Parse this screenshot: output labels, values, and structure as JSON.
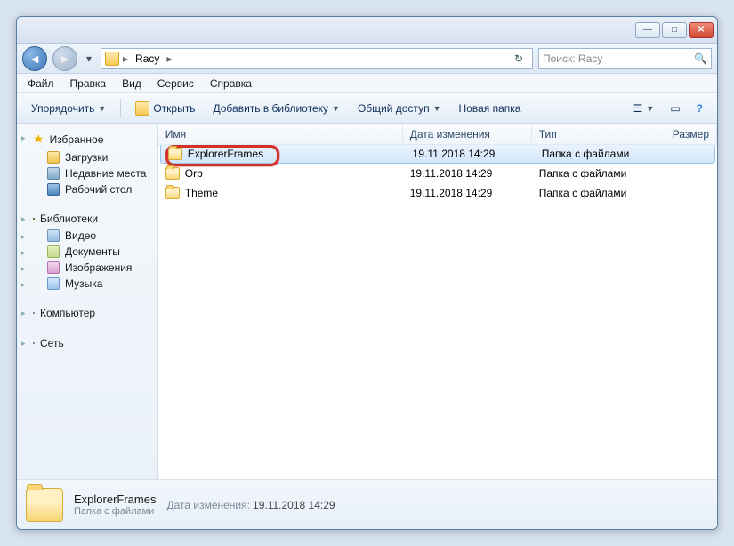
{
  "titlebar": {
    "min": "—",
    "max": "□",
    "close": "✕"
  },
  "nav": {
    "back": "◄",
    "forward": "►",
    "dropdown": "▾",
    "crumb_root": "",
    "crumb_folder": "Racy",
    "sep": "▸",
    "refresh": "↻"
  },
  "search": {
    "placeholder": "Поиск: Racy",
    "icon": "🔍"
  },
  "menubar": {
    "file": "Файл",
    "edit": "Правка",
    "view": "Вид",
    "tools": "Сервис",
    "help": "Справка"
  },
  "toolbar": {
    "organize": "Упорядочить",
    "open": "Открыть",
    "addlib": "Добавить в библиотеку",
    "share": "Общий доступ",
    "newfolder": "Новая папка",
    "view_icon": "☰",
    "preview_icon": "▭",
    "help_icon": "?"
  },
  "sidebar": {
    "favorites": {
      "label": "Избранное",
      "items": [
        {
          "label": "Загрузки",
          "cls": "dl"
        },
        {
          "label": "Недавние места",
          "cls": "recent"
        },
        {
          "label": "Рабочий стол",
          "cls": "desk"
        }
      ]
    },
    "libraries": {
      "label": "Библиотеки",
      "items": [
        {
          "label": "Видео",
          "cls": "vid"
        },
        {
          "label": "Документы",
          "cls": "doc"
        },
        {
          "label": "Изображения",
          "cls": "img"
        },
        {
          "label": "Музыка",
          "cls": "mus"
        }
      ]
    },
    "computer": {
      "label": "Компьютер"
    },
    "network": {
      "label": "Сеть"
    }
  },
  "columns": {
    "name": "Имя",
    "date": "Дата изменения",
    "type": "Тип",
    "size": "Размер"
  },
  "files": [
    {
      "name": "ExplorerFrames",
      "date": "19.11.2018 14:29",
      "type": "Папка с файлами",
      "selected": true,
      "highlighted": true
    },
    {
      "name": "Orb",
      "date": "19.11.2018 14:29",
      "type": "Папка с файлами",
      "selected": false
    },
    {
      "name": "Theme",
      "date": "19.11.2018 14:29",
      "type": "Папка с файлами",
      "selected": false
    }
  ],
  "details": {
    "name": "ExplorerFrames",
    "date_label": "Дата изменения:",
    "date_value": "19.11.2018 14:29",
    "type": "Папка с файлами"
  }
}
